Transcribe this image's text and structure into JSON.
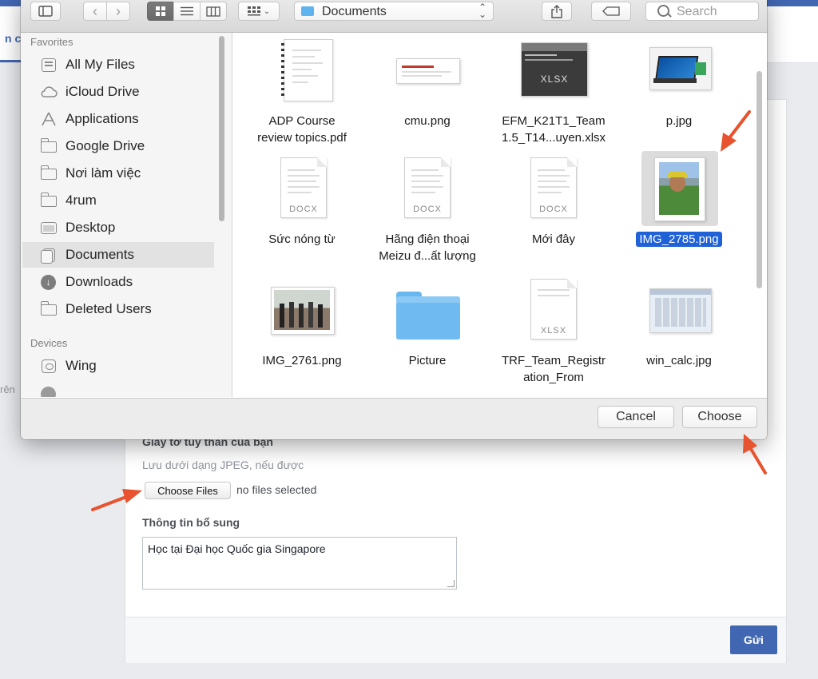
{
  "background_page": {
    "tab_partial": "n ch",
    "left_partial": "rên",
    "section_label": "Giấy tờ tùy thân của bạn",
    "file_hint": "Lưu dưới dạng JPEG, nếu được",
    "choose_files_label": "Choose Files",
    "no_files_label": "no files selected",
    "extra_info_label": "Thông tin bổ sung",
    "extra_info_value": "Học tại Đại học Quốc gia Singapore",
    "submit_label": "Gửi"
  },
  "dialog": {
    "location": "Documents",
    "search_placeholder": "Search",
    "sidebar": {
      "favorites_header": "Favorites",
      "favorites": [
        {
          "label": "All My Files",
          "icon": "all-files-icon"
        },
        {
          "label": "iCloud Drive",
          "icon": "cloud-icon"
        },
        {
          "label": "Applications",
          "icon": "applications-icon"
        },
        {
          "label": "Google Drive",
          "icon": "folder-icon"
        },
        {
          "label": "Nơi làm việc",
          "icon": "folder-icon"
        },
        {
          "label": "4rum",
          "icon": "folder-icon"
        },
        {
          "label": "Desktop",
          "icon": "desktop-icon"
        },
        {
          "label": "Documents",
          "icon": "documents-icon",
          "selected": true
        },
        {
          "label": "Downloads",
          "icon": "downloads-icon"
        },
        {
          "label": "Deleted Users",
          "icon": "folder-icon"
        }
      ],
      "devices_header": "Devices",
      "devices": [
        {
          "label": "Wing",
          "icon": "disk-icon"
        }
      ]
    },
    "files": [
      {
        "name_line1": "ADP Course",
        "name_line2": "review topics.pdf",
        "kind": "pdf"
      },
      {
        "name_line1": "cmu.png",
        "name_line2": "",
        "kind": "image"
      },
      {
        "name_line1": "EFM_K21T1_Team",
        "name_line2": "1.5_T14...uyen.xlsx",
        "kind": "xlsx-thumb",
        "tag": "XLSX"
      },
      {
        "name_line1": "p.jpg",
        "name_line2": "",
        "kind": "image"
      },
      {
        "name_line1": "Sức nóng từ",
        "name_line2": "",
        "kind": "docx",
        "tag": "DOCX"
      },
      {
        "name_line1": "Hãng điện thoại",
        "name_line2": "Meizu đ...ất lượng",
        "kind": "docx",
        "tag": "DOCX"
      },
      {
        "name_line1": "Mới đây",
        "name_line2": "",
        "kind": "docx",
        "tag": "DOCX"
      },
      {
        "name_line1": "IMG_2785.png",
        "name_line2": "",
        "kind": "photo",
        "selected": true
      },
      {
        "name_line1": "IMG_2761.png",
        "name_line2": "",
        "kind": "photo"
      },
      {
        "name_line1": "Picture",
        "name_line2": "",
        "kind": "folder"
      },
      {
        "name_line1": "TRF_Team_Registr",
        "name_line2": "ation_From",
        "kind": "xlsx",
        "tag": "XLSX"
      },
      {
        "name_line1": "win_calc.jpg",
        "name_line2": "",
        "kind": "image"
      }
    ],
    "cancel_label": "Cancel",
    "choose_label": "Choose"
  },
  "colors": {
    "accent_blue": "#4267b2",
    "selection_blue": "#1f61d6",
    "annotation_arrow": "#e8532f"
  }
}
